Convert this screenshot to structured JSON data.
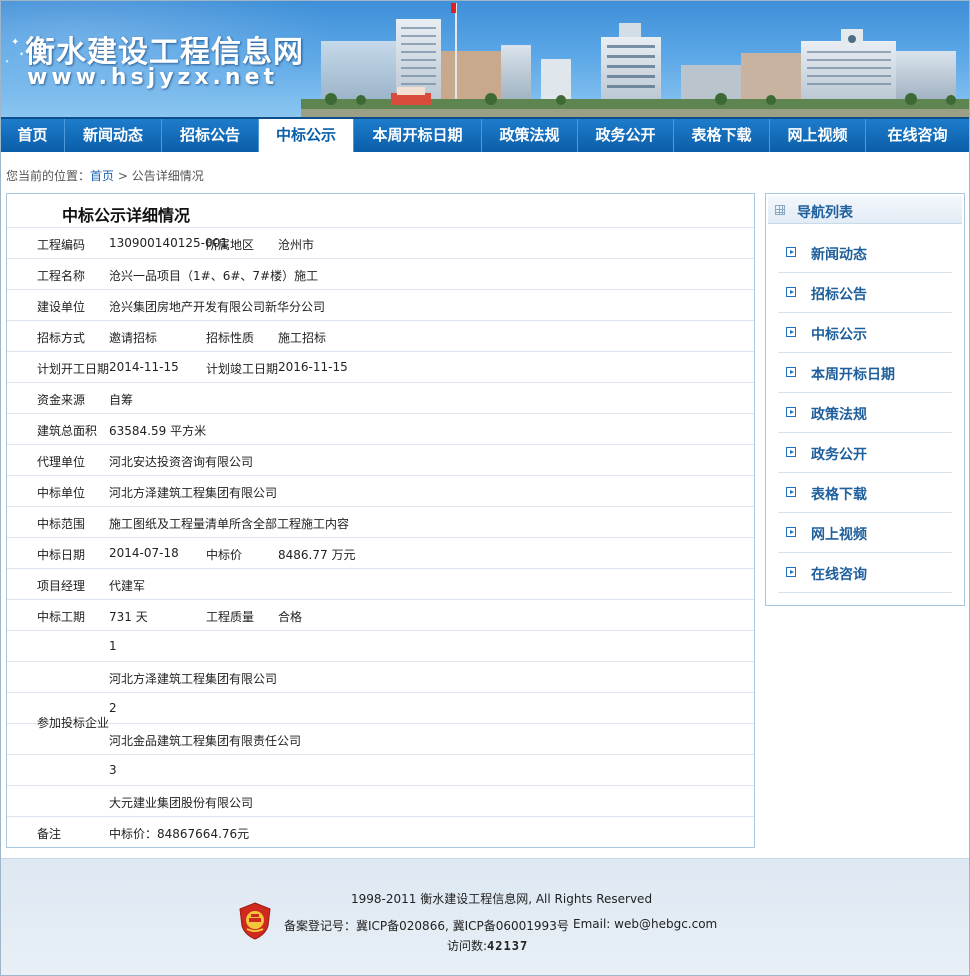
{
  "header": {
    "site_title": "衡水建设工程信息网",
    "site_url": "www.hsjyzx.net"
  },
  "nav": {
    "items": [
      {
        "label": "首页"
      },
      {
        "label": "新闻动态"
      },
      {
        "label": "招标公告"
      },
      {
        "label": "中标公示"
      },
      {
        "label": "本周开标日期"
      },
      {
        "label": "政策法规"
      },
      {
        "label": "政务公开"
      },
      {
        "label": "表格下载"
      },
      {
        "label": "网上视频"
      },
      {
        "label": "在线咨询"
      }
    ],
    "active_index": 3
  },
  "breadcrumb": {
    "prefix": "您当前的位置：",
    "home": "首页",
    "separator": " > ",
    "current": "公告详细情况"
  },
  "detail": {
    "title": "中标公示详细情况",
    "rows": [
      {
        "c1": "工程编码",
        "c2": "130900140125-001",
        "c3": "所属地区",
        "c4": "沧州市"
      },
      {
        "c1": "工程名称",
        "c2": "沧兴一品项目（1#、6#、7#楼）施工",
        "c3": "",
        "c4": ""
      },
      {
        "c1": "建设单位",
        "c2": "沧兴集团房地产开发有限公司新华分公司",
        "c3": "",
        "c4": ""
      },
      {
        "c1": "招标方式",
        "c2": "邀请招标",
        "c3": "招标性质",
        "c4": "施工招标"
      },
      {
        "c1": "计划开工日期",
        "c2": "2014-11-15",
        "c3": "计划竣工日期",
        "c4": "2016-11-15"
      },
      {
        "c1": "资金来源",
        "c2": "自筹",
        "c3": "",
        "c4": ""
      },
      {
        "c1": "建筑总面积",
        "c2": "63584.59 平方米",
        "c3": "",
        "c4": ""
      },
      {
        "c1": "代理单位",
        "c2": "河北安达投资咨询有限公司",
        "c3": "",
        "c4": ""
      },
      {
        "c1": "中标单位",
        "c2": "河北方泽建筑工程集团有限公司",
        "c3": "",
        "c4": ""
      },
      {
        "c1": "中标范围",
        "c2": "施工图纸及工程量清单所含全部工程施工内容",
        "c3": "",
        "c4": ""
      },
      {
        "c1": "中标日期",
        "c2": "2014-07-18",
        "c3": "中标价",
        "c4": "8486.77 万元"
      },
      {
        "c1": "项目经理",
        "c2": "代建军",
        "c3": "",
        "c4": ""
      },
      {
        "c1": "中标工期",
        "c2": "731 天",
        "c3": "工程质量",
        "c4": "合格"
      },
      {
        "c1": "",
        "c2": "1",
        "c3": "",
        "c4": ""
      },
      {
        "c1": "",
        "c2": "河北方泽建筑工程集团有限公司",
        "c3": "",
        "c4": ""
      },
      {
        "c1": "",
        "c2": "2",
        "c3": "",
        "c4": ""
      },
      {
        "c1": "",
        "c2": "河北金品建筑工程集团有限责任公司",
        "c3": "",
        "c4": ""
      },
      {
        "c1": "",
        "c2": "3",
        "c3": "",
        "c4": ""
      },
      {
        "c1": "",
        "c2": "大元建业集团股份有限公司",
        "c3": "",
        "c4": ""
      },
      {
        "c1": "备注",
        "c2": "中标价：84867664.76元",
        "c3": "",
        "c4": ""
      }
    ],
    "bidders_label": "参加投标企业"
  },
  "sidebar": {
    "title": "导航列表",
    "items": [
      {
        "label": "新闻动态"
      },
      {
        "label": "招标公告"
      },
      {
        "label": "中标公示"
      },
      {
        "label": "本周开标日期"
      },
      {
        "label": "政策法规"
      },
      {
        "label": "政务公开"
      },
      {
        "label": "表格下载"
      },
      {
        "label": "网上视频"
      },
      {
        "label": "在线咨询"
      }
    ]
  },
  "footer": {
    "copyright": "1998-2011 衡水建设工程信息网, All Rights Reserved",
    "icp": "备案登记号：冀ICP备020866, 冀ICP备06001993号",
    "email": "Email: web@hebgc.com",
    "visits_label": "访问数:",
    "visits_count": "42137"
  },
  "colors": {
    "nav_bg": "#0b5ea8",
    "link": "#1a66b3",
    "sidebar_text": "#1f5f9c"
  }
}
